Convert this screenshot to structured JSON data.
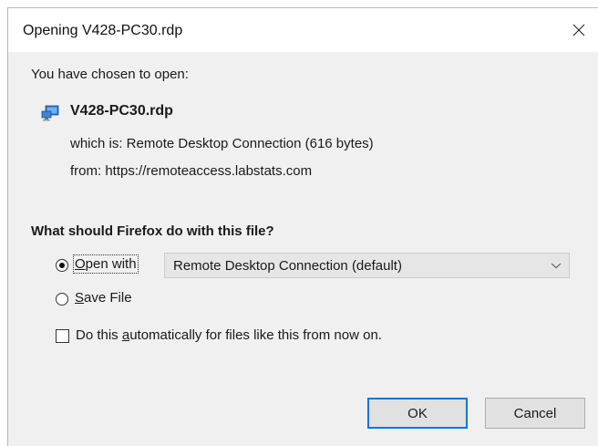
{
  "window": {
    "title": "Opening V428-PC30.rdp"
  },
  "file": {
    "intro": "You have chosen to open:",
    "name": "V428-PC30.rdp",
    "which_is": "which is: Remote Desktop Connection (616 bytes)",
    "from_label": "from:",
    "from_url": "https://remoteaccess.labstats.com"
  },
  "action": {
    "question": "What should Firefox do with this file?",
    "open_with_label": "Open with",
    "open_with_access_key": "O",
    "open_with_rest": "pen with",
    "open_with_selected": true,
    "application_select_value": "Remote Desktop Connection (default)",
    "save_file_label": "Save File",
    "save_file_access_key": "S",
    "save_file_rest": "ave File",
    "save_file_selected": false,
    "auto_prefix": "Do this ",
    "auto_access_key": "a",
    "auto_suffix": "utomatically for files like this from now on.",
    "auto_checked": false
  },
  "buttons": {
    "ok_label": "OK",
    "cancel_label": "Cancel"
  },
  "icons": {
    "file": "remote-desktop-file-icon",
    "close": "close-icon",
    "dropdown": "chevron-down-icon"
  },
  "colors": {
    "focus_border": "#0078d7",
    "content_background": "#f0f0f0"
  }
}
